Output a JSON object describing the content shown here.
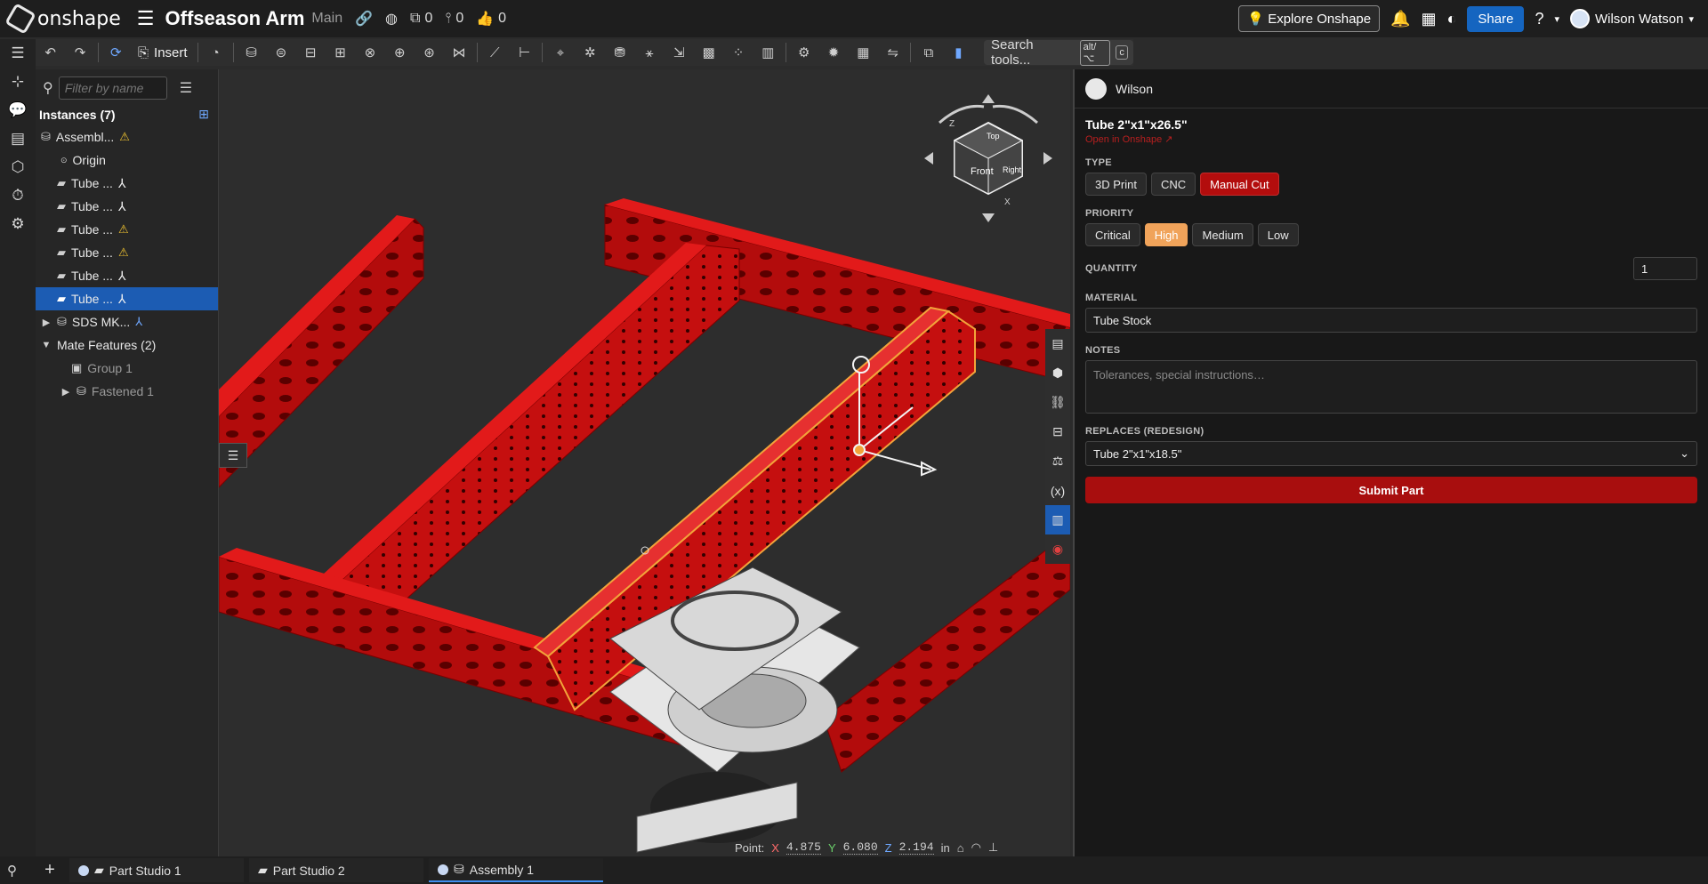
{
  "app": {
    "logo_text": "onshape"
  },
  "doc": {
    "title": "Offseason Arm",
    "branch": "Main",
    "versions_count": "0",
    "branches_count": "0",
    "likes_count": "0"
  },
  "topbar": {
    "explore_label": "Explore Onshape",
    "share_label": "Share",
    "help_label": "?",
    "user_name": "Wilson Watson"
  },
  "toolbar": {
    "insert_label": "Insert",
    "search_label": "Search tools...",
    "search_shortcut_1": "alt/⌥",
    "search_shortcut_2": "c"
  },
  "tree": {
    "filter_placeholder": "Filter by name",
    "instances_header": "Instances (7)",
    "items": [
      {
        "label": "Assembl..."
      },
      {
        "label": "Origin"
      },
      {
        "label": "Tube ..."
      },
      {
        "label": "Tube ..."
      },
      {
        "label": "Tube ..."
      },
      {
        "label": "Tube ..."
      },
      {
        "label": "Tube ..."
      },
      {
        "label": "Tube ..."
      },
      {
        "label": "SDS MK..."
      }
    ],
    "mate_header": "Mate Features (2)",
    "mates": [
      {
        "label": "Group 1"
      },
      {
        "label": "Fastened 1"
      }
    ]
  },
  "viewcube": {
    "top": "Top",
    "front": "Front",
    "right": "Right",
    "axis_z": "Z",
    "axis_x": "X"
  },
  "statusbar": {
    "point_label": "Point:",
    "x_label": "X",
    "x": "4.875",
    "y_label": "Y",
    "y": "6.080",
    "z_label": "Z",
    "z": "2.194",
    "unit": "in"
  },
  "panel": {
    "user": "Wilson",
    "part_title": "Tube 2\"x1\"x26.5\"",
    "open_link": "Open in Onshape ↗",
    "type_label": "TYPE",
    "types": [
      "3D Print",
      "CNC",
      "Manual Cut"
    ],
    "type_selected": "Manual Cut",
    "priority_label": "PRIORITY",
    "priorities": [
      "Critical",
      "High",
      "Medium",
      "Low"
    ],
    "priority_selected": "High",
    "quantity_label": "QUANTITY",
    "quantity": "1",
    "material_label": "MATERIAL",
    "material": "Tube Stock",
    "notes_label": "NOTES",
    "notes_placeholder": "Tolerances, special instructions…",
    "replaces_label": "REPLACES (REDESIGN)",
    "replaces_value": "Tube 2\"x1\"x18.5\"",
    "submit_label": "Submit Part"
  },
  "tabs": [
    {
      "label": "Part Studio 1",
      "active": false
    },
    {
      "label": "Part Studio 2",
      "active": false
    },
    {
      "label": "Assembly 1",
      "active": true
    }
  ],
  "colors": {
    "accent_blue": "#1565c0",
    "tube_red": "#d10f0f",
    "selection": "#f2a33a",
    "submit_red": "#a80e0e"
  }
}
